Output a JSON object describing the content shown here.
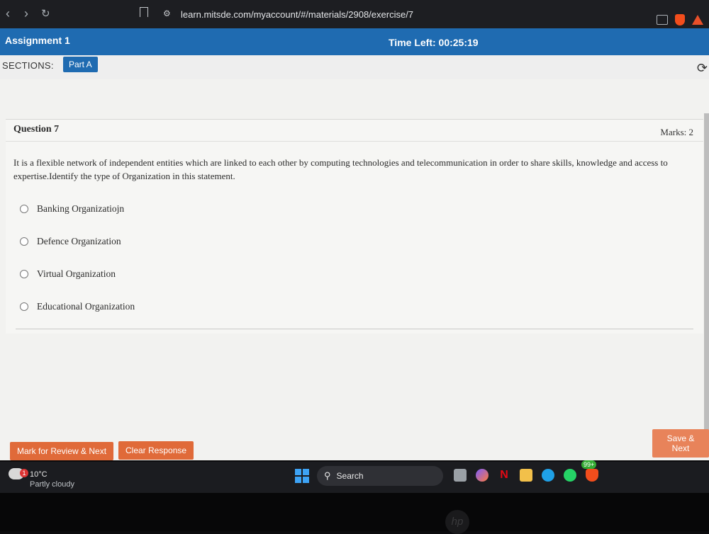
{
  "browser": {
    "url": "learn.mitsde.com/myaccount/#/materials/2908/exercise/7"
  },
  "header": {
    "title": "Assignment 1",
    "time_left": "Time Left: 00:25:19"
  },
  "sections": {
    "label": "SECTIONS:",
    "tabs": [
      {
        "label": "Part A",
        "active": true
      }
    ]
  },
  "question": {
    "number_label": "Question 7",
    "marks": "Marks: 2",
    "text": "It is a flexible network of independent entities which are linked to each other by computing technologies and telecommunication in order to share skills, knowledge and access to expertise.Identify the type of Organization in this statement.",
    "options": [
      {
        "label": "Banking Organizatiojn",
        "selected": false
      },
      {
        "label": "Defence Organization",
        "selected": false
      },
      {
        "label": "Virtual Organization",
        "selected": false
      },
      {
        "label": "Educational Organization",
        "selected": false
      }
    ]
  },
  "actions": {
    "mark_review": "Mark for Review & Next",
    "clear_response": "Clear Response",
    "save_next": "Save & Next"
  },
  "taskbar": {
    "weather_temp": "10°C",
    "weather_desc": "Partly cloudy",
    "weather_badge": "1",
    "search_label": "Search",
    "notification_count": "99+",
    "netflix_letter": "N"
  },
  "colors": {
    "header_blue": "#1f6bb1",
    "button_orange": "#e06a39"
  }
}
